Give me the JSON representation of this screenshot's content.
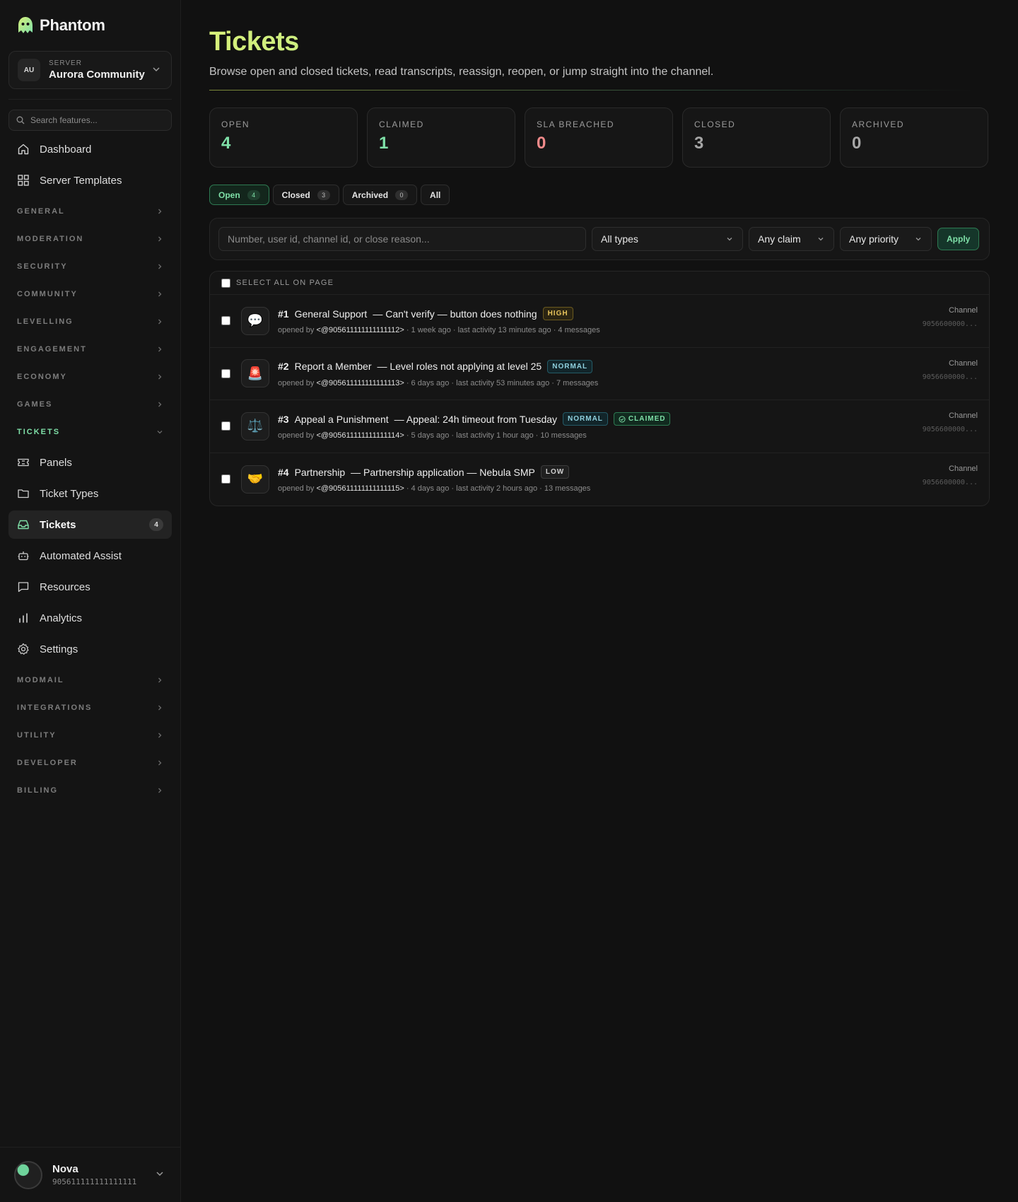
{
  "app": {
    "name": "Phantom"
  },
  "server": {
    "label": "SERVER",
    "initials": "AU",
    "name": "Aurora Community"
  },
  "search": {
    "placeholder": "Search features..."
  },
  "nav_top": [
    {
      "label": "Dashboard",
      "icon": "home-icon"
    },
    {
      "label": "Server Templates",
      "icon": "grid-icon"
    }
  ],
  "sections_before": [
    "GENERAL",
    "MODERATION",
    "SECURITY",
    "COMMUNITY",
    "LEVELLING",
    "ENGAGEMENT",
    "ECONOMY",
    "GAMES"
  ],
  "tickets_section": {
    "label": "TICKETS",
    "items": [
      {
        "label": "Panels",
        "icon": "ticket-icon"
      },
      {
        "label": "Ticket Types",
        "icon": "folder-icon"
      },
      {
        "label": "Tickets",
        "icon": "inbox-icon",
        "badge": "4",
        "active": true
      },
      {
        "label": "Automated Assist",
        "icon": "bot-icon"
      },
      {
        "label": "Resources",
        "icon": "message-square-icon"
      },
      {
        "label": "Analytics",
        "icon": "bar-chart-icon"
      },
      {
        "label": "Settings",
        "icon": "gear-icon"
      }
    ]
  },
  "sections_after": [
    "MODMAIL",
    "INTEGRATIONS",
    "UTILITY",
    "DEVELOPER",
    "BILLING"
  ],
  "user": {
    "name": "Nova",
    "id": "905611111111111111"
  },
  "page": {
    "title": "Tickets",
    "subtitle": "Browse open and closed tickets, read transcripts, reassign, reopen, or jump straight into the channel."
  },
  "stats": [
    {
      "label": "OPEN",
      "value": "4",
      "color": "#7fe0a8"
    },
    {
      "label": "CLAIMED",
      "value": "1",
      "color": "#7fe0a8"
    },
    {
      "label": "SLA BREACHED",
      "value": "0",
      "color": "#f08a8a"
    },
    {
      "label": "CLOSED",
      "value": "3",
      "color": "#a6a6a6"
    },
    {
      "label": "ARCHIVED",
      "value": "0",
      "color": "#a6a6a6"
    }
  ],
  "tabs": [
    {
      "label": "Open",
      "count": "4",
      "active": true
    },
    {
      "label": "Closed",
      "count": "3"
    },
    {
      "label": "Archived",
      "count": "0"
    },
    {
      "label": "All"
    }
  ],
  "filters": {
    "query_placeholder": "Number, user id, channel id, or close reason...",
    "type": "All types",
    "claim": "Any claim",
    "priority": "Any priority",
    "apply_label": "Apply"
  },
  "list": {
    "select_all_label": "SELECT ALL ON PAGE",
    "tickets": [
      {
        "number": "#1",
        "type": "General Support",
        "subject": "— Can't verify — button does nothing",
        "priority": "HIGH",
        "priority_class": "badge-high",
        "claimed": false,
        "emoji": "💬",
        "opened_by_prefix": "opened by ",
        "user_mention": "<@905611111111111112>",
        "meta": " · 1 week ago · last activity 13 minutes ago · 4 messages",
        "side_label": "Channel",
        "side_value": "9056600000..."
      },
      {
        "number": "#2",
        "type": "Report a Member",
        "subject": "— Level roles not applying at level 25",
        "priority": "NORMAL",
        "priority_class": "badge-normal",
        "claimed": false,
        "emoji": "🚨",
        "opened_by_prefix": "opened by ",
        "user_mention": "<@905611111111111113>",
        "meta": " · 6 days ago · last activity 53 minutes ago · 7 messages",
        "side_label": "Channel",
        "side_value": "9056600000..."
      },
      {
        "number": "#3",
        "type": "Appeal a Punishment",
        "subject": "— Appeal: 24h timeout from Tuesday",
        "priority": "NORMAL",
        "priority_class": "badge-normal",
        "claimed": true,
        "claimed_label": "CLAIMED",
        "emoji": "⚖️",
        "opened_by_prefix": "opened by ",
        "user_mention": "<@905611111111111114>",
        "meta": " · 5 days ago · last activity 1 hour ago · 10 messages",
        "side_label": "Channel",
        "side_value": "9056600000..."
      },
      {
        "number": "#4",
        "type": "Partnership",
        "subject": "— Partnership application — Nebula SMP",
        "priority": "LOW",
        "priority_class": "badge-low",
        "claimed": false,
        "emoji": "🤝",
        "opened_by_prefix": "opened by ",
        "user_mention": "<@905611111111111115>",
        "meta": " · 4 days ago · last activity 2 hours ago · 13 messages",
        "side_label": "Channel",
        "side_value": "9056600000..."
      }
    ]
  }
}
